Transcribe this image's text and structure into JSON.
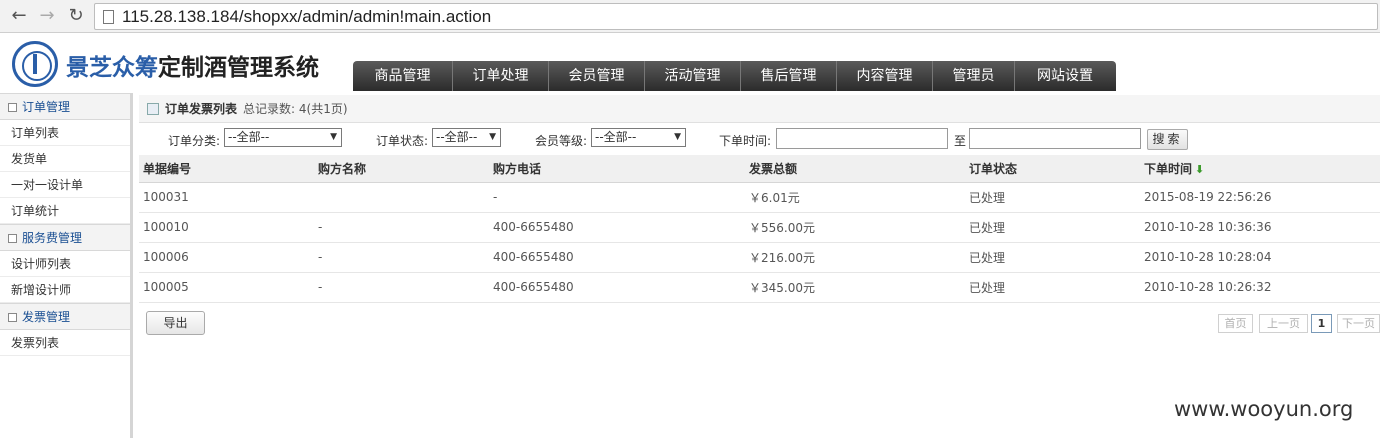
{
  "browser": {
    "url": "115.28.138.184/shopxx/admin/admin!main.action"
  },
  "header": {
    "logo_part1": "景芝众筹",
    "logo_part2": "定制酒管理系统",
    "nav": [
      "商品管理",
      "订单处理",
      "会员管理",
      "活动管理",
      "售后管理",
      "内容管理",
      "管理员",
      "网站设置"
    ]
  },
  "sidebar": {
    "groups": [
      {
        "title": "订单管理",
        "items": [
          "订单列表",
          "发货单",
          "一对一设计单",
          "订单统计"
        ]
      },
      {
        "title": "服务费管理",
        "items": [
          "设计师列表",
          "新增设计师"
        ]
      },
      {
        "title": "发票管理",
        "items": [
          "发票列表"
        ]
      }
    ]
  },
  "main": {
    "title": "订单发票列表",
    "count": "总记录数: 4(共1页)",
    "filters": {
      "category_label": "订单分类:",
      "category_value": "--全部--",
      "status_label": "订单状态:",
      "status_value": "--全部--",
      "level_label": "会员等级:",
      "level_value": "--全部--",
      "time_label": "下单时间:",
      "to_label": "至",
      "search_label": "搜索"
    },
    "columns": [
      "单据编号",
      "购方名称",
      "购方电话",
      "发票总额",
      "订单状态",
      "下单时间"
    ],
    "rows": [
      [
        "100031",
        "",
        "-",
        "￥6.01元",
        "已处理",
        "2015-08-19 22:56:26"
      ],
      [
        "100010",
        "-",
        "400-6655480",
        "￥556.00元",
        "已处理",
        "2010-10-28 10:36:36"
      ],
      [
        "100006",
        "-",
        "400-6655480",
        "￥216.00元",
        "已处理",
        "2010-10-28 10:28:04"
      ],
      [
        "100005",
        "-",
        "400-6655480",
        "￥345.00元",
        "已处理",
        "2010-10-28 10:26:32"
      ]
    ],
    "export_label": "导出",
    "pager": {
      "first": "首页",
      "prev": "上一页",
      "current": "1",
      "next": "下一页"
    }
  },
  "watermark": "www.wooyun.org"
}
